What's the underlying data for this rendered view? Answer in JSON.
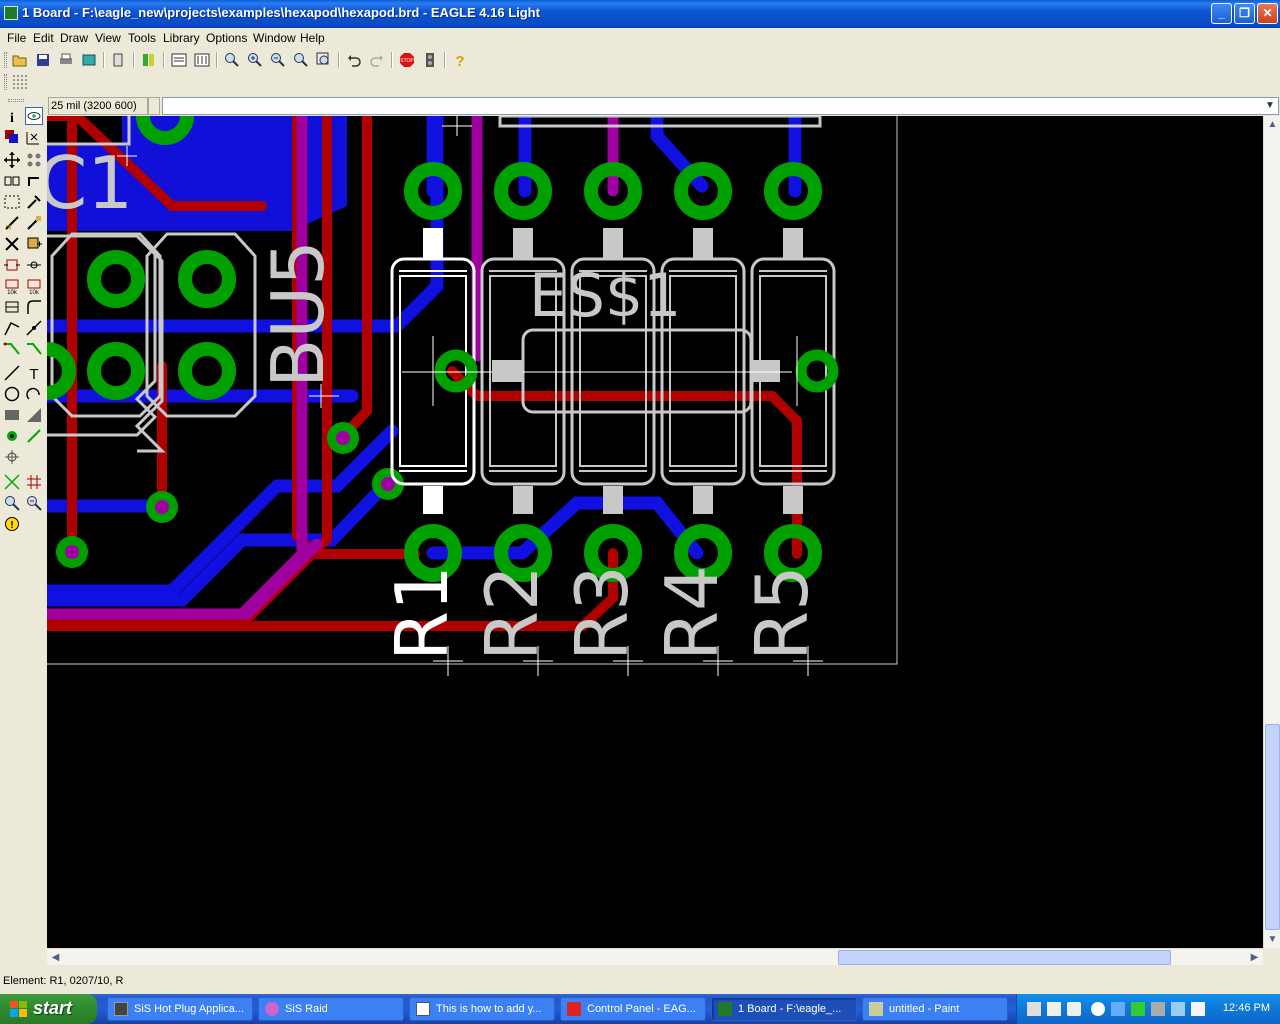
{
  "window": {
    "title": "1 Board - F:\\eagle_new\\projects\\examples\\hexapod\\hexapod.brd - EAGLE 4.16 Light"
  },
  "menu": [
    "File",
    "Edit",
    "Draw",
    "View",
    "Tools",
    "Library",
    "Options",
    "Window",
    "Help"
  ],
  "coords": "25 mil (3200 600)",
  "command": "",
  "board": {
    "labels": {
      "c1": "C1",
      "bu5": "BU5",
      "es1": "ES$1",
      "r1": "R1",
      "r2": "R2",
      "r3": "R3",
      "r4": "R4",
      "r5": "R5"
    },
    "colors": {
      "background": "#000000",
      "top": "#B00000",
      "bottom": "#1010E0",
      "pad": "#00A000",
      "silk": "#C8C8C8",
      "via": "#A000A0"
    }
  },
  "status": "Element: R1, 0207/10, R",
  "taskbar": {
    "start": "start",
    "items": [
      "SiS Hot Plug Applica...",
      "SiS Raid",
      "This is how to add y...",
      "Control Panel - EAG...",
      "1 Board - F:\\eagle_...",
      "untitled - Paint"
    ],
    "clock": "12:46 PM"
  }
}
